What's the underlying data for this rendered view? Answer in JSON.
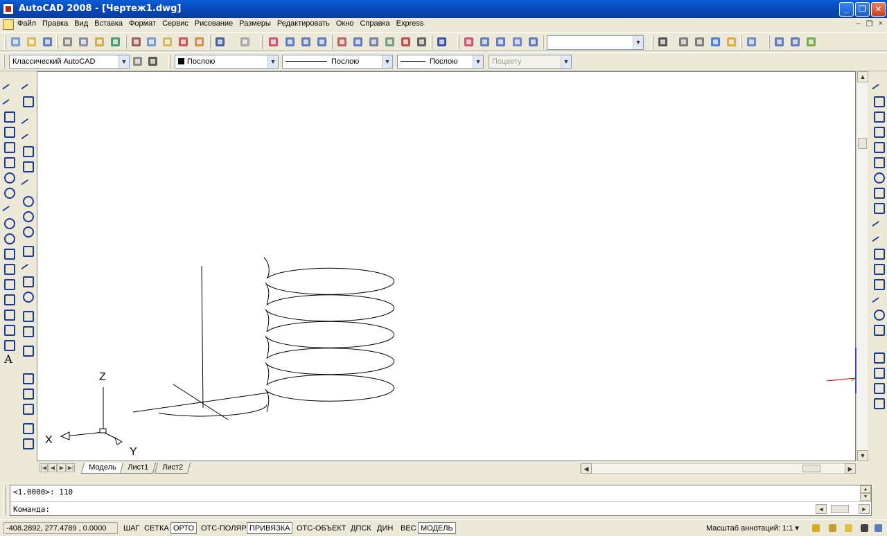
{
  "window": {
    "title": "AutoCAD 2008 - [Чертеж1.dwg]",
    "minimize": "_",
    "restore": "❐",
    "close": "✕"
  },
  "menu": {
    "items": [
      "Файл",
      "Правка",
      "Вид",
      "Вставка",
      "Формат",
      "Сервис",
      "Рисование",
      "Размеры",
      "Редактировать",
      "Окно",
      "Справка",
      "Express"
    ],
    "mdi": [
      "–",
      "❐",
      "×"
    ]
  },
  "toolbar2": {
    "workspace": "Классический AutoCAD",
    "color": "Послою",
    "linetype": "Послою",
    "lineweight": "Послою",
    "plotstyle": "Поцвету"
  },
  "canvas": {
    "ucs_x": "X",
    "ucs_y": "Y",
    "ucs_z": "Z",
    "helix_turns": 5
  },
  "tabs": [
    "Модель",
    "Лист1",
    "Лист2"
  ],
  "command": {
    "history": "<1.0000>: 110",
    "prompt": "Команда:"
  },
  "status": {
    "coords": "-408.2892, 277.4789 , 0.0000",
    "buttons": [
      "ШАГ",
      "СЕТКА",
      "ОРТО",
      "ОТС-ПОЛЯР",
      "ПРИВЯЗКА",
      "ОТС-ОБЪЕКТ",
      "ДПСК",
      "ДИН",
      "ВЕС",
      "МОДЕЛЬ"
    ],
    "active": [
      "ОРТО",
      "ПРИВЯЗКА",
      "МОДЕЛЬ"
    ],
    "annotation_label": "Масштаб аннотаций:",
    "annotation_scale": "1:1 ▾"
  },
  "colors": {
    "title_bar": "#0a4bc0",
    "canvas_bg": "#ffffff",
    "drawing_stroke": "#000000"
  }
}
